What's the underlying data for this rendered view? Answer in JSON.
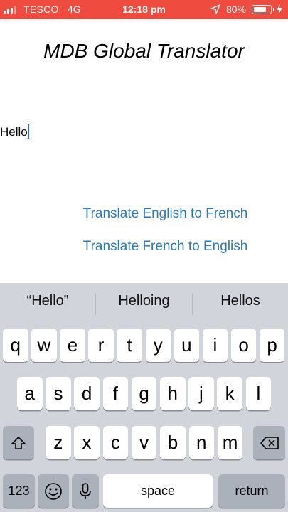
{
  "status_bar": {
    "carrier": "TESCO",
    "network": "4G",
    "time": "12:18 pm",
    "battery_percent": "80%",
    "battery_level": 0.8
  },
  "title": "MDB Global Translator",
  "input": {
    "value": "Hello"
  },
  "buttons": {
    "en_to_fr": "Translate English to French",
    "fr_to_en": "Translate French to English"
  },
  "keyboard": {
    "suggestions": [
      "“Hello”",
      "Helloing",
      "Hellos"
    ],
    "row1": [
      "q",
      "w",
      "e",
      "r",
      "t",
      "y",
      "u",
      "i",
      "o",
      "p"
    ],
    "row2": [
      "a",
      "s",
      "d",
      "f",
      "g",
      "h",
      "j",
      "k",
      "l"
    ],
    "row3": [
      "z",
      "x",
      "c",
      "v",
      "b",
      "n",
      "m"
    ],
    "numbers_key": "123",
    "space_key": "space",
    "return_key": "return",
    "shift_icon": "shift-icon",
    "delete_icon": "backspace-icon",
    "emoji_icon": "emoji-icon",
    "mic_icon": "microphone-icon"
  }
}
